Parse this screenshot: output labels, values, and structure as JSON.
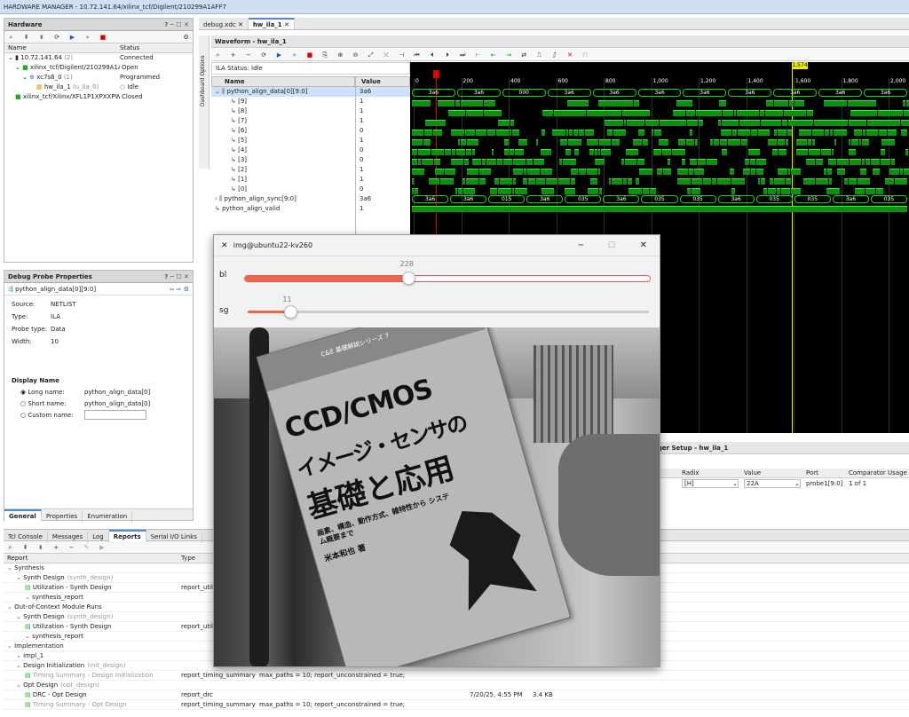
{
  "app": {
    "title": "HARDWARE MANAGER - 10.72.141.64/xilinx_tcf/Digilent/210299A1AFF7"
  },
  "hardware": {
    "title": "Hardware",
    "col_name": "Name",
    "col_status": "Status",
    "rows": [
      {
        "name": "10.72.141.64",
        "extra": "(2)",
        "status": "Connected"
      },
      {
        "name": "xilinx_tcf/Digilent/210299A1AFF7",
        "extra": "",
        "status": "Open"
      },
      {
        "name": "xc7s6_0",
        "extra": "(1)",
        "status": "Programmed"
      },
      {
        "name": "hw_ila_1",
        "extra": "(u_ila_0)",
        "status": "Idle"
      },
      {
        "name": "xilinx_tcf/Xilinx/XFL1P1XPXXPW",
        "extra": "",
        "status": "Closed"
      }
    ]
  },
  "probe_props": {
    "title": "Debug Probe Properties",
    "probe": "python_align_data[0][9:0]",
    "source_label": "Source:",
    "source": "NETLIST",
    "type_label": "Type:",
    "type": "ILA",
    "probe_type_label": "Probe type:",
    "probe_type": "Data",
    "width_label": "Width:",
    "width": "10",
    "display_name": "Display Name",
    "long_label": "Long name:",
    "long_value": "python_align_data[0]",
    "short_label": "Short name:",
    "short_value": "python_align_data[0]",
    "custom_label": "Custom name:",
    "tabs": [
      "General",
      "Properties",
      "Enumeration"
    ]
  },
  "editor_tabs": [
    "debug.xdc",
    "hw_ila_1"
  ],
  "waveform": {
    "title": "Waveform - hw_ila_1",
    "status": "ILA Status: Idle",
    "col_name": "Name",
    "col_value": "Value",
    "marker": "1,574",
    "ticks": [
      "0",
      "200",
      "400",
      "600",
      "800",
      "1,000",
      "1,200",
      "1,400",
      "1,600",
      "1,800",
      "2,000"
    ],
    "dashboard": "Dashboard Options",
    "signals": [
      {
        "name": "python_align_data[0][9:0]",
        "value": "3a6",
        "kind": "bus"
      },
      {
        "name": "[9]",
        "value": "1",
        "kind": "bit"
      },
      {
        "name": "[8]",
        "value": "1",
        "kind": "bit"
      },
      {
        "name": "[7]",
        "value": "1",
        "kind": "bit"
      },
      {
        "name": "[6]",
        "value": "0",
        "kind": "bit"
      },
      {
        "name": "[5]",
        "value": "1",
        "kind": "bit"
      },
      {
        "name": "[4]",
        "value": "0",
        "kind": "bit"
      },
      {
        "name": "[3]",
        "value": "0",
        "kind": "bit"
      },
      {
        "name": "[2]",
        "value": "1",
        "kind": "bit"
      },
      {
        "name": "[1]",
        "value": "1",
        "kind": "bit"
      },
      {
        "name": "[0]",
        "value": "0",
        "kind": "bit"
      },
      {
        "name": "python_align_sync[9:0]",
        "value": "3a6",
        "kind": "bus"
      },
      {
        "name": "python_align_valid",
        "value": "1",
        "kind": "bit"
      }
    ],
    "bus1_labels": [
      "3a6",
      "3a6",
      "000",
      "3a6",
      "3a6",
      "3a6",
      "3a6",
      "3a6",
      "3a6",
      "3a6",
      "3a6"
    ],
    "bus2_labels": [
      "3a6",
      "3a6",
      "015",
      "3a6",
      "035",
      "3a6",
      "035",
      "035",
      "3a6",
      "035",
      "035",
      "3a6",
      "035"
    ]
  },
  "trigger": {
    "title": "Trigger Setup - hw_ila_1",
    "columns": [
      "Radix",
      "Value",
      "Port",
      "Comparator Usage"
    ],
    "row": {
      "radix": "[H]",
      "value": "22A",
      "port": "probe1[9:0]",
      "usage": "1 of 1"
    }
  },
  "reports": {
    "tabs": [
      "Tcl Console",
      "Messages",
      "Log",
      "Reports",
      "Serial I/O Links"
    ],
    "col_report": "Report",
    "col_type": "Type",
    "rows": [
      {
        "name": "Synthesis",
        "sub": "",
        "type": "",
        "extra": "",
        "indent": 0
      },
      {
        "name": "Synth Design",
        "sub": "(synth_design)",
        "type": "",
        "extra": "",
        "indent": 1
      },
      {
        "name": "Utilization - Synth Design",
        "sub": "",
        "type": "report_utiliz",
        "extra": "",
        "indent": 2
      },
      {
        "name": "synthesis_report",
        "sub": "",
        "type": "",
        "extra": "",
        "indent": 2
      },
      {
        "name": "Out-of-Context Module Runs",
        "sub": "",
        "type": "",
        "extra": "",
        "indent": 0
      },
      {
        "name": "Synth Design",
        "sub": "(synth_design)",
        "type": "",
        "extra": "",
        "indent": 1
      },
      {
        "name": "Utilization - Synth Design",
        "sub": "",
        "type": "report_utiliz",
        "extra": "",
        "indent": 2
      },
      {
        "name": "synthesis_report",
        "sub": "",
        "type": "",
        "extra": "",
        "indent": 2
      },
      {
        "name": "Implementation",
        "sub": "",
        "type": "",
        "extra": "",
        "indent": 0
      },
      {
        "name": "impl_1",
        "sub": "",
        "type": "",
        "extra": "",
        "indent": 1
      },
      {
        "name": "Design Initialization",
        "sub": "(init_design)",
        "type": "",
        "extra": "",
        "indent": 1
      },
      {
        "name": "Timing Summary - Design Initialization",
        "sub": "",
        "type": "report_timing_summary",
        "extra": "max_paths = 10; report_unconstrained = true;",
        "indent": 2,
        "muted": true
      },
      {
        "name": "Opt Design",
        "sub": "(opt_design)",
        "type": "",
        "extra": "",
        "indent": 1
      },
      {
        "name": "DRC - Opt Design",
        "sub": "",
        "type": "report_drc",
        "extra": "",
        "date": "7/20/25, 4:55 PM",
        "size": "3.4 KB",
        "indent": 2
      },
      {
        "name": "Timing Summary - Opt Design",
        "sub": "",
        "type": "report_timing_summary",
        "extra": "max_paths = 10; report_unconstrained = true;",
        "indent": 2,
        "muted": true
      }
    ]
  },
  "img_window": {
    "title": "img@ubuntu22-kv260",
    "slider1": {
      "label": "bl",
      "value": "228",
      "fraction": 0.403
    },
    "slider2": {
      "label": "sg",
      "value": "11",
      "fraction": 0.107
    },
    "book": {
      "series": "C&E 基礎解説シリーズ 7",
      "title1": "CCD/CMOS",
      "title2": "イメージ・センサの",
      "title3": "基礎と応用",
      "subtitle": "画素、構造、動作方式、雑特性から システム概要まで",
      "author": "米本和也 著"
    }
  }
}
